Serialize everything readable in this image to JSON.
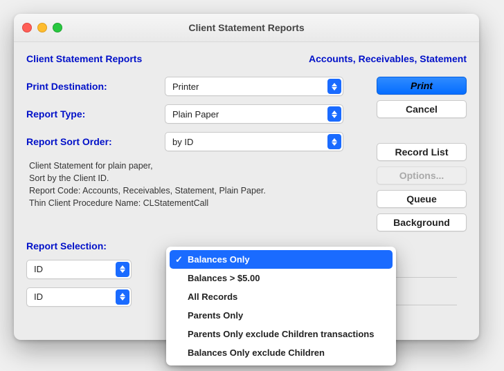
{
  "window": {
    "title": "Client Statement Reports"
  },
  "header": {
    "left": "Client Statement Reports",
    "right": "Accounts, Receivables, Statement"
  },
  "fields": {
    "print_dest": {
      "label": "Print Destination:",
      "value": "Printer"
    },
    "report_type": {
      "label": "Report Type:",
      "value": "Plain Paper"
    },
    "sort_order": {
      "label": "Report Sort Order:",
      "value": "by ID"
    }
  },
  "description": {
    "l1": "Client Statement for plain paper,",
    "l2": "Sort by the Client ID.",
    "l3": "Report Code: Accounts, Receivables, Statement, Plain Paper.",
    "l4": "Thin Client Procedure Name: CLStatementCall"
  },
  "buttons": {
    "print": "Print",
    "cancel": "Cancel",
    "record_list": "Record List",
    "options": "Options...",
    "queue": "Queue",
    "background": "Background"
  },
  "report_selection": {
    "label": "Report Selection:",
    "id1": "ID",
    "id2": "ID"
  },
  "dropdown": {
    "items": [
      "Balances Only",
      "Balances > $5.00",
      "All Records",
      "Parents Only",
      "Parents Only exclude Children transactions",
      "Balances Only exclude Children"
    ],
    "selected_index": 0
  }
}
